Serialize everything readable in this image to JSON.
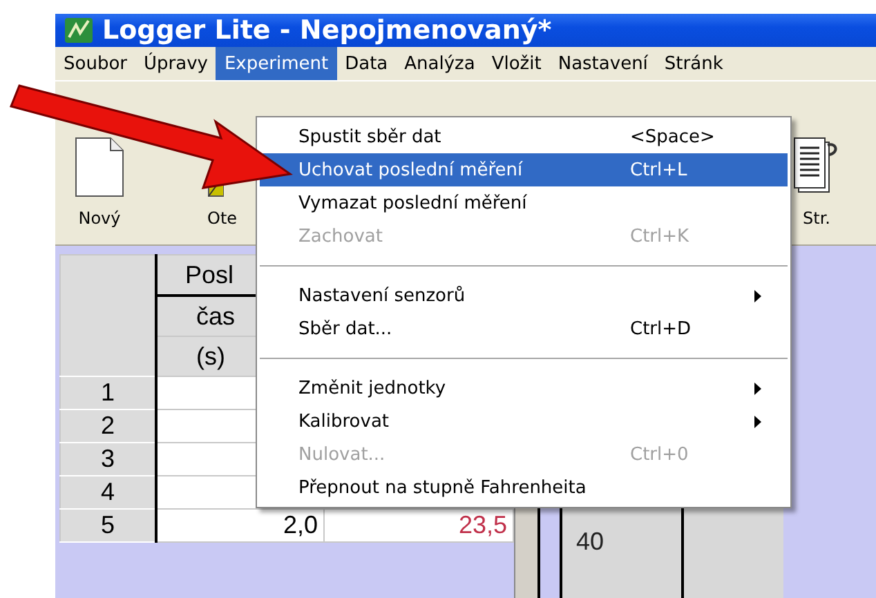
{
  "window": {
    "title": "Logger Lite - Nepojmenovaný*"
  },
  "menu_bar": [
    {
      "label": "Soubor",
      "selected": false
    },
    {
      "label": "Úpravy",
      "selected": false
    },
    {
      "label": "Experiment",
      "selected": true
    },
    {
      "label": "Data",
      "selected": false
    },
    {
      "label": "Analýza",
      "selected": false
    },
    {
      "label": "Vložit",
      "selected": false
    },
    {
      "label": "Nastavení",
      "selected": false
    },
    {
      "label": "Stránk",
      "selected": false
    }
  ],
  "toolbar": [
    {
      "kind": "new",
      "label": "Nový"
    },
    {
      "kind": "open",
      "label": "Ote"
    },
    {
      "kind": "page",
      "label": "Str."
    }
  ],
  "menu": [
    {
      "kind": "item",
      "label": "Spustit sběr dat",
      "shortcut": "<Space>",
      "disabled": false,
      "selected": false,
      "submenu": false
    },
    {
      "kind": "item",
      "label": "Uchovat poslední měření",
      "shortcut": "Ctrl+L",
      "disabled": false,
      "selected": true,
      "submenu": false
    },
    {
      "kind": "item",
      "label": "Vymazat poslední měření",
      "disabled": false,
      "selected": false,
      "submenu": false
    },
    {
      "kind": "item",
      "label": "Zachovat",
      "shortcut": "Ctrl+K",
      "disabled": true,
      "selected": false,
      "submenu": false
    },
    {
      "kind": "separator"
    },
    {
      "kind": "item",
      "label": "Nastavení senzorů",
      "disabled": false,
      "selected": false,
      "submenu": true
    },
    {
      "kind": "item",
      "label": "Sběr dat...",
      "shortcut": "Ctrl+D",
      "disabled": false,
      "selected": false,
      "submenu": false
    },
    {
      "kind": "separator"
    },
    {
      "kind": "item",
      "label": "Změnit jednotky",
      "disabled": false,
      "selected": false,
      "submenu": true
    },
    {
      "kind": "item",
      "label": "Kalibrovat",
      "disabled": false,
      "selected": false,
      "submenu": true
    },
    {
      "kind": "item",
      "label": "Nulovat...",
      "shortcut": "Ctrl+0",
      "disabled": true,
      "selected": false,
      "submenu": false
    },
    {
      "kind": "item",
      "label": "Přepnout na stupně Fahrenheita",
      "disabled": false,
      "selected": false,
      "submenu": false
    }
  ],
  "table": {
    "header": [
      "Posl",
      "čas",
      "(s)"
    ],
    "rows": [
      {
        "number": "1"
      },
      {
        "number": "2"
      },
      {
        "number": "3"
      },
      {
        "number": "4"
      },
      {
        "number": "5",
        "column_2": "2,0",
        "column_3": "23,5"
      }
    ]
  },
  "graph": {
    "tick": "40"
  }
}
